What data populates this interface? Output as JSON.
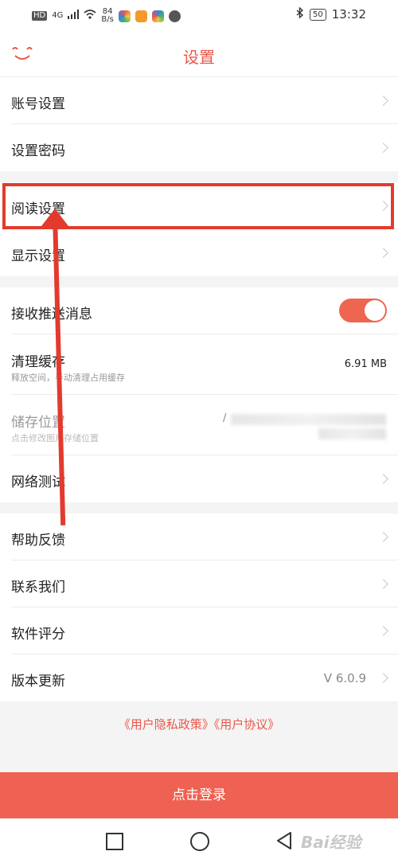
{
  "status_bar": {
    "hd": "HD",
    "net": "4G",
    "speed_value": "84",
    "speed_unit": "B/s",
    "battery": "50",
    "time": "13:32"
  },
  "header": {
    "title": "设置"
  },
  "items": {
    "account": "账号设置",
    "password": "设置密码",
    "reading": "阅读设置",
    "display": "显示设置",
    "push": "接收推送消息",
    "cache": "清理缓存",
    "cache_sub": "释放空间，手动清理占用缓存",
    "cache_value": "6.91 MB",
    "storage": "储存位置",
    "storage_sub": "点击修改图片存储位置",
    "storage_value": "/",
    "network": "网络测试",
    "help": "帮助反馈",
    "contact": "联系我们",
    "rating": "软件评分",
    "version": "版本更新",
    "version_value": "V 6.0.9"
  },
  "push_enabled": true,
  "links": "《用户隐私政策》《用户协议》",
  "login_button": "点击登录",
  "watermark": "Bai经验",
  "colors": {
    "accent": "#e8584a",
    "highlight": "#e23b2e",
    "toggle_on": "#ee6650"
  },
  "icons": [
    "back-icon",
    "chevron-right-icon",
    "bluetooth-icon",
    "wifi-icon",
    "nav-recent-icon",
    "nav-home-icon",
    "nav-back-icon"
  ]
}
